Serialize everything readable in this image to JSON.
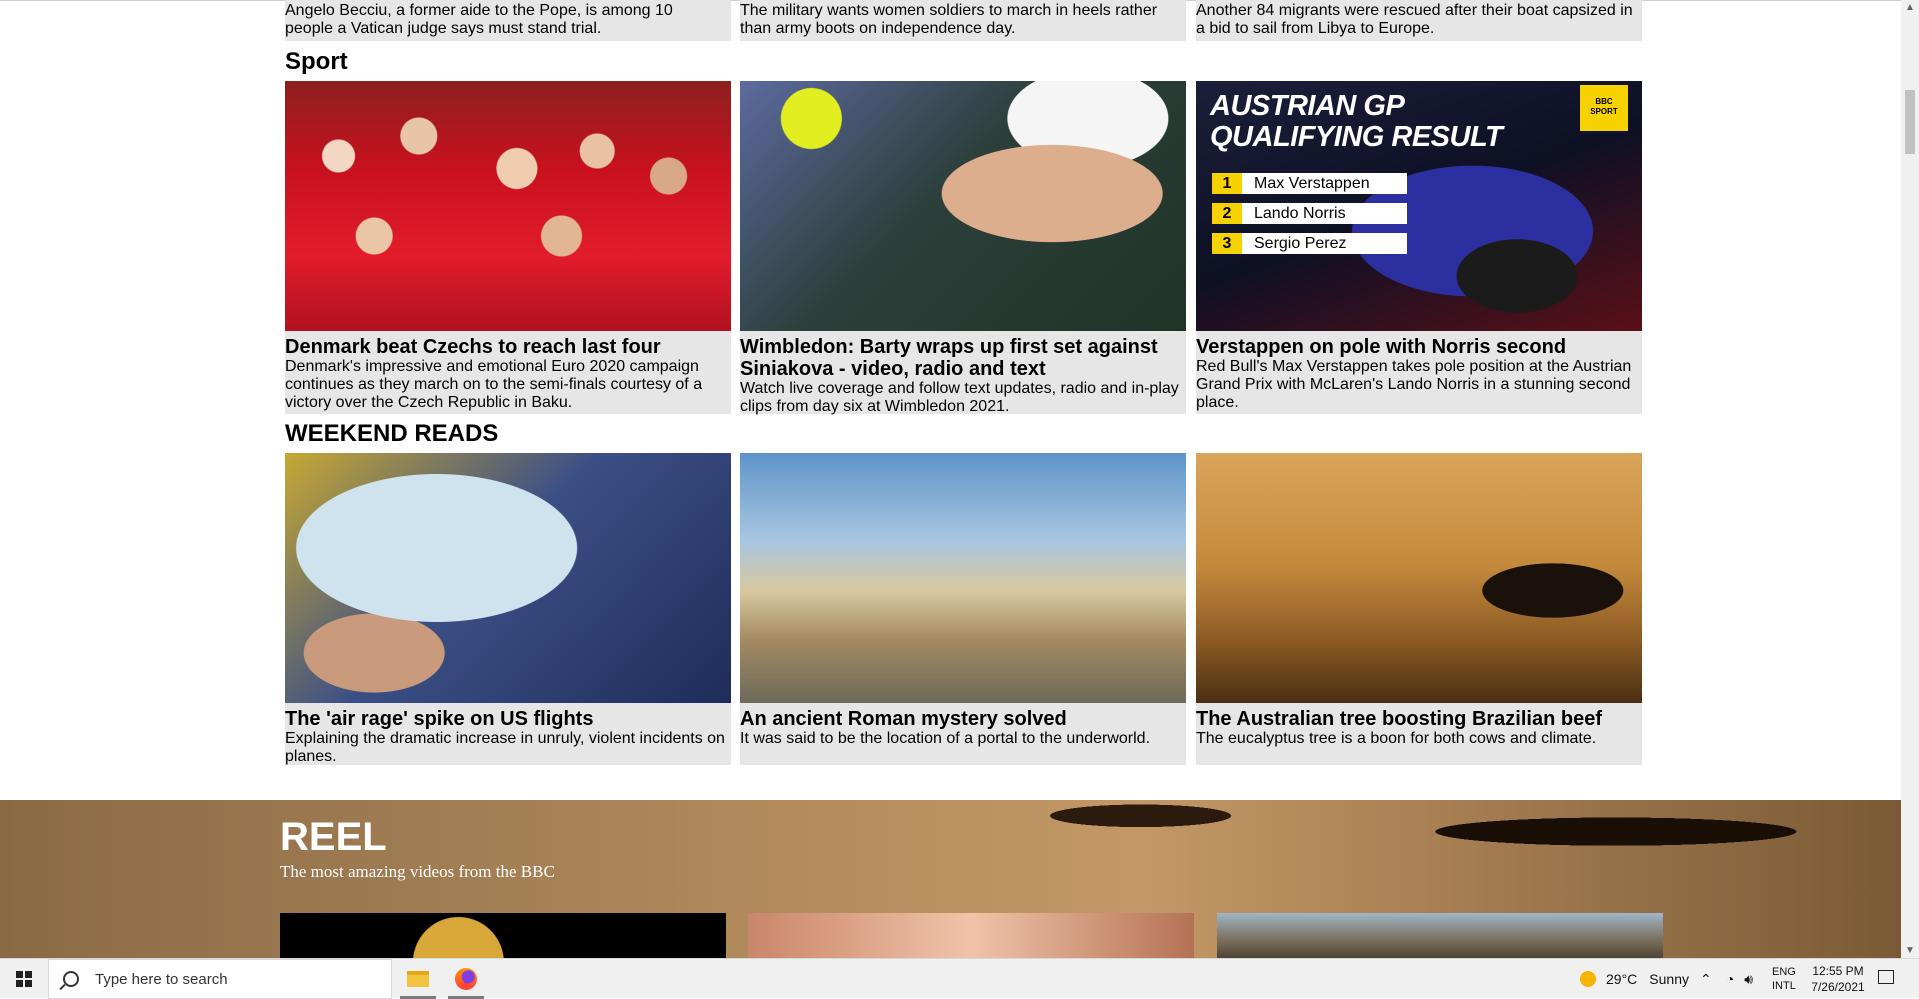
{
  "top_row": [
    {
      "text": "Angelo Becciu, a former aide to the Pope, is among 10 people a Vatican judge says must stand trial."
    },
    {
      "text": "The military wants women soldiers to march in heels rather than army boots on independence day."
    },
    {
      "text": "Another 84 migrants were rescued after their boat capsized in a bid to sail from Libya to Europe."
    }
  ],
  "sport": {
    "title": "Sport",
    "cards": [
      {
        "headline": "Denmark beat Czechs to reach last four",
        "summary": "Denmark's impressive and emotional Euro 2020 campaign continues as they march on to the semi-finals courtesy of a victory over the Czech Republic in Baku."
      },
      {
        "headline": "Wimbledon: Barty wraps up first set against Siniakova - video, radio and text",
        "summary": "Watch live coverage and follow text updates, radio and in-play clips from day six at Wimbledon 2021."
      },
      {
        "headline": "Verstappen on pole with Norris second",
        "summary": "Red Bull's Max Verstappen takes pole position at the Austrian Grand Prix with McLaren's Lando Norris in a stunning second place."
      }
    ],
    "f1_graphic": {
      "title_line1": "AUSTRIAN GP",
      "title_line2": "QUALIFYING RESULT",
      "badge_line1": "BBC",
      "badge_line2": "SPORT",
      "results": [
        {
          "pos": "1",
          "name": "Max Verstappen"
        },
        {
          "pos": "2",
          "name": "Lando Norris"
        },
        {
          "pos": "3",
          "name": "Sergio Perez"
        }
      ]
    }
  },
  "weekend": {
    "title": "WEEKEND READS",
    "cards": [
      {
        "headline": "The 'air rage' spike on US flights",
        "summary": "Explaining the dramatic increase in unruly, violent incidents on planes."
      },
      {
        "headline": "An ancient Roman mystery solved",
        "summary": "It was said to be the location of a portal to the underworld."
      },
      {
        "headline": "The Australian tree boosting Brazilian beef",
        "summary": "The eucalyptus tree is a boon for both cows and climate."
      }
    ]
  },
  "reel": {
    "title": "REEL",
    "subtitle": "The most amazing videos from the BBC"
  },
  "taskbar": {
    "search_placeholder": "Type here to search",
    "weather_temp": "29°C",
    "weather_text": "Sunny",
    "lang_top": "ENG",
    "lang_bottom": "INTL",
    "time": "12:55 PM",
    "date": "7/26/2021"
  },
  "colors": {
    "card_bg": "#e6e6e6",
    "f1_yellow": "#f6d300",
    "taskbar_bg": "#f0f0f0"
  }
}
